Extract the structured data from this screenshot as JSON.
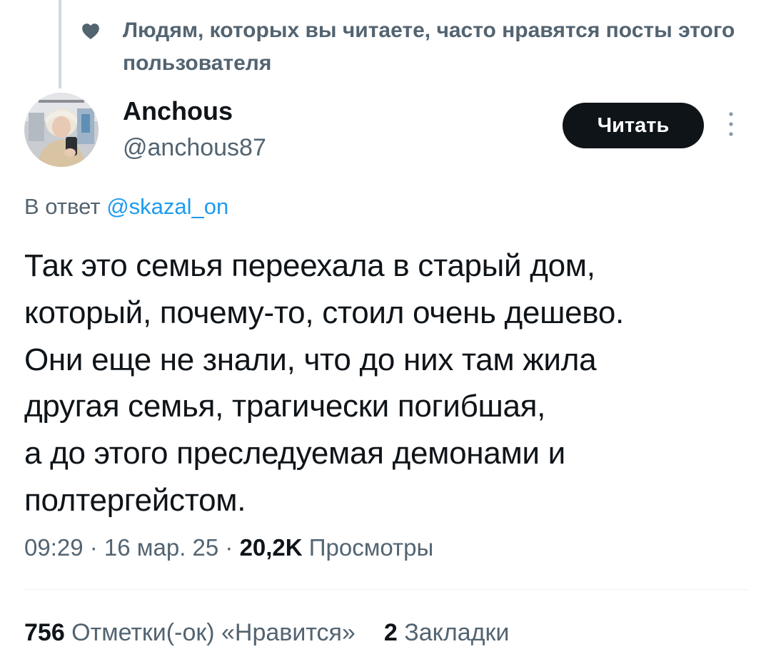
{
  "social_context": {
    "icon": "heart-icon",
    "text": "Людям, которых вы читаете, часто нравятся посты этого пользователя"
  },
  "author": {
    "name": "Anchous",
    "handle": "@anchous87"
  },
  "follow_button": {
    "label": "Читать"
  },
  "more_icon": "more-vertical-icon",
  "reply": {
    "prefix": "В ответ ",
    "mention": "@skazal_on"
  },
  "tweet": {
    "text": "Так это семья переехала в старый дом,\nкоторый, почему-то, стоил очень дешево.\nОни еще не знали, что до них там жила\nдругая семья, трагически погибшая,\nа до этого преследуемая демонами и\nполтергейстом."
  },
  "meta": {
    "time": "09:29",
    "sep1": " · ",
    "date": "16 мар. 25",
    "sep2": " · ",
    "views_count": "20,2K",
    "views_label": " Просмотры"
  },
  "stats": {
    "likes_count": "756",
    "likes_label": " Отметки(-ок) «Нравится»",
    "bookmarks_count": "2",
    "bookmarks_label": " Закладки"
  },
  "colors": {
    "text_primary": "#0f1419",
    "text_secondary": "#536471",
    "link": "#1d9bf0",
    "button_bg": "#0f1419",
    "button_text": "#ffffff"
  }
}
